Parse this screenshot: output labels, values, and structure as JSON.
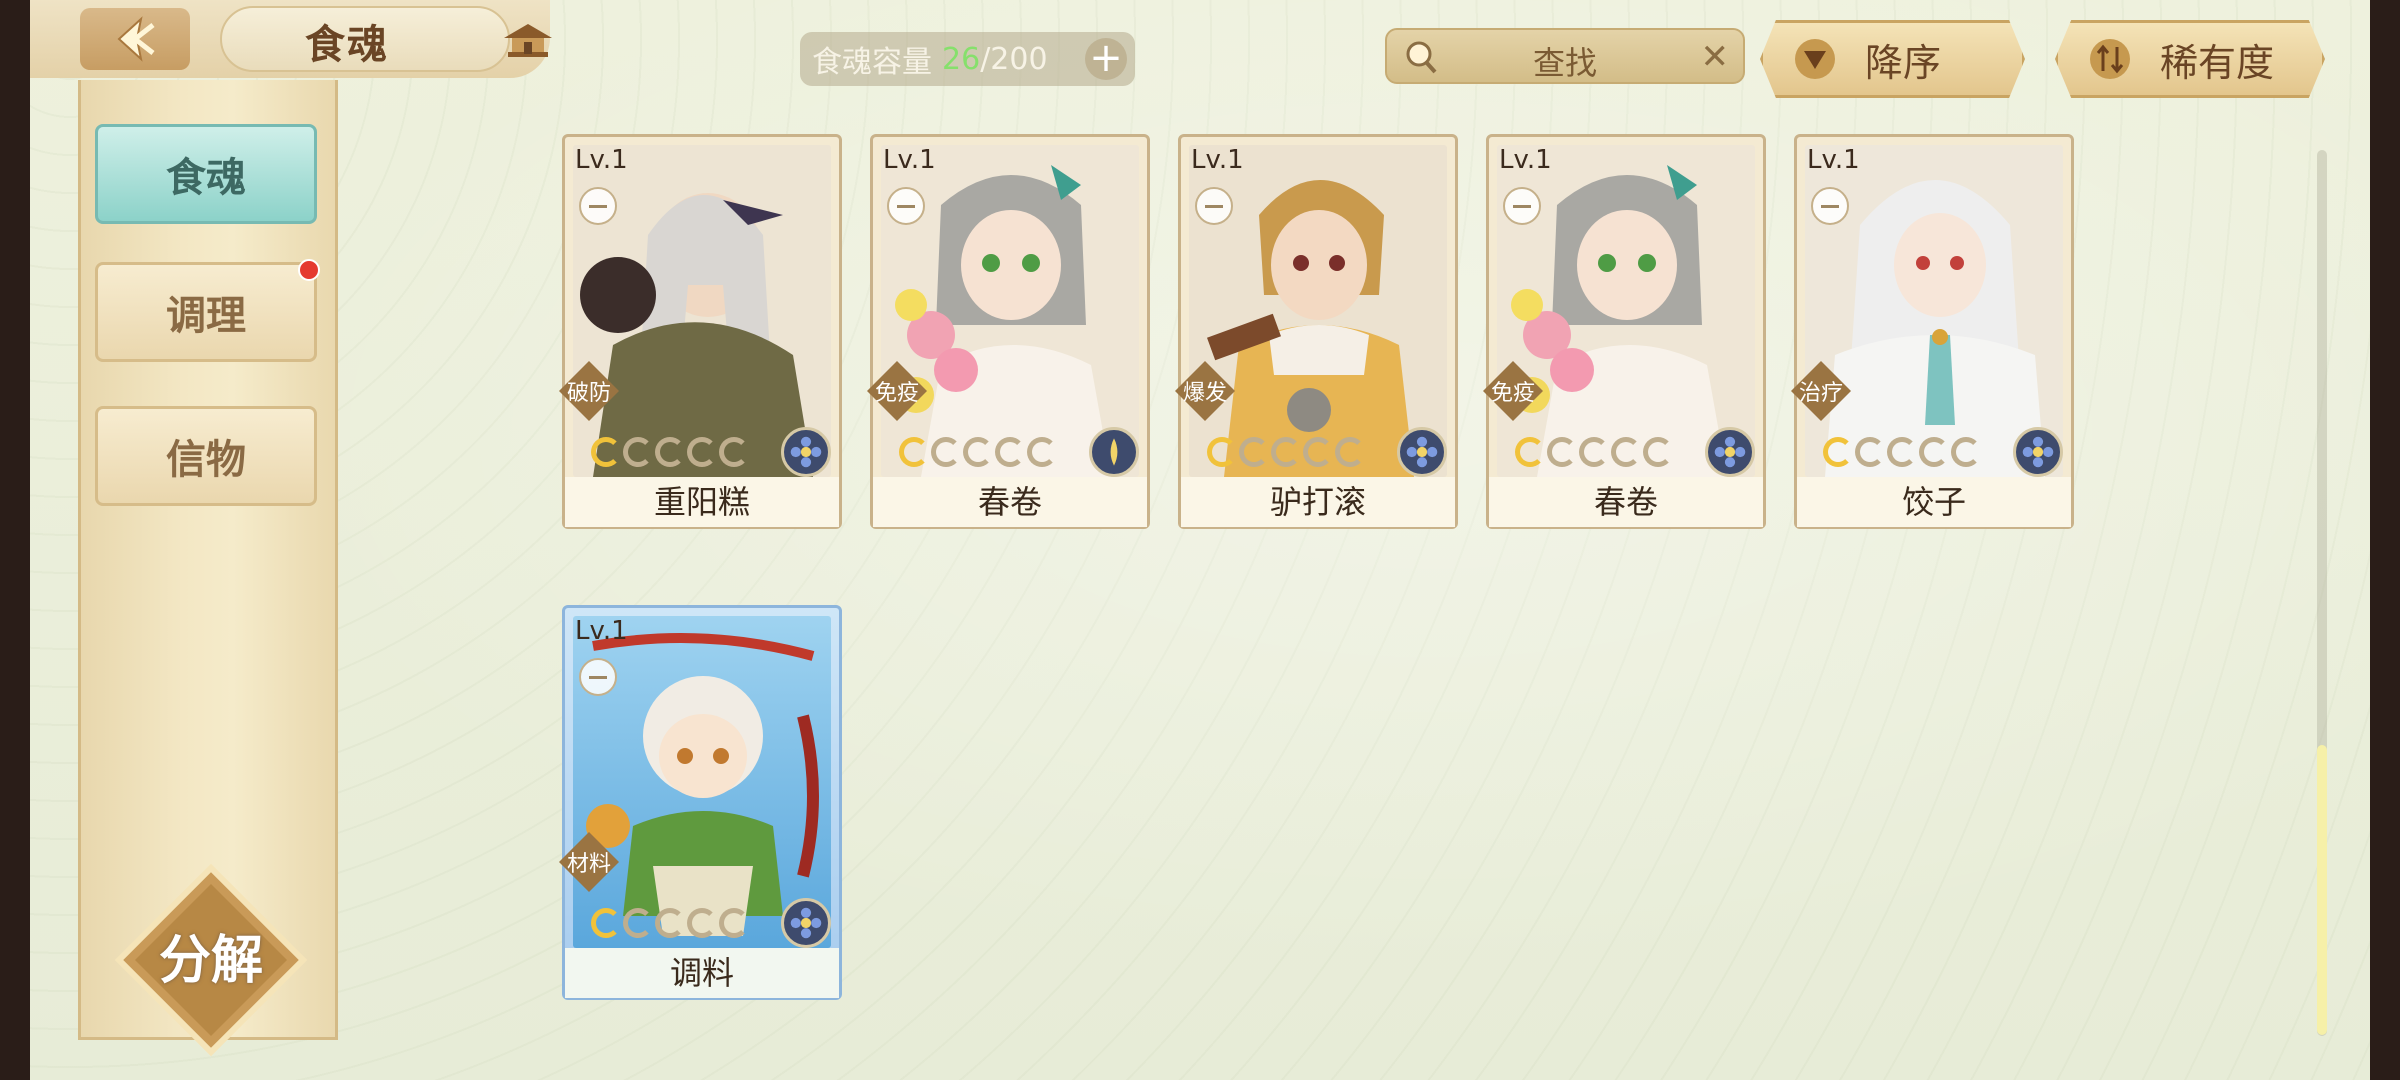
{
  "header": {
    "title": "食魂",
    "capacity_label": "食魂容量",
    "capacity_current": "26",
    "capacity_total": "/200",
    "search_placeholder": "查找",
    "sort_order_label": "降序",
    "sort_by_label": "稀有度"
  },
  "sidebar": {
    "tabs": [
      {
        "label": "食魂",
        "active": true
      },
      {
        "label": "调理",
        "active": false,
        "badge": true
      },
      {
        "label": "信物",
        "active": false
      }
    ],
    "decompose_label": "分解"
  },
  "cards": [
    {
      "level": "Lv.1",
      "role": "破防",
      "name": "重阳糕",
      "stars_filled": 1,
      "stars_total": 5
    },
    {
      "level": "Lv.1",
      "role": "免疫",
      "name": "春卷",
      "stars_filled": 1,
      "stars_total": 5
    },
    {
      "level": "Lv.1",
      "role": "爆发",
      "name": "驴打滚",
      "stars_filled": 1,
      "stars_total": 5
    },
    {
      "level": "Lv.1",
      "role": "免疫",
      "name": "春卷",
      "stars_filled": 1,
      "stars_total": 5
    },
    {
      "level": "Lv.1",
      "role": "治疗",
      "name": "饺子",
      "stars_filled": 1,
      "stars_total": 5
    },
    {
      "level": "Lv.1",
      "role": "材料",
      "name": "调料",
      "stars_filled": 1,
      "stars_total": 5
    }
  ],
  "colors": {
    "accent_teal": "#8cd2c9",
    "capacity_green": "#86e06c",
    "gold": "#f1c23a",
    "badge_red": "#e53a30"
  }
}
